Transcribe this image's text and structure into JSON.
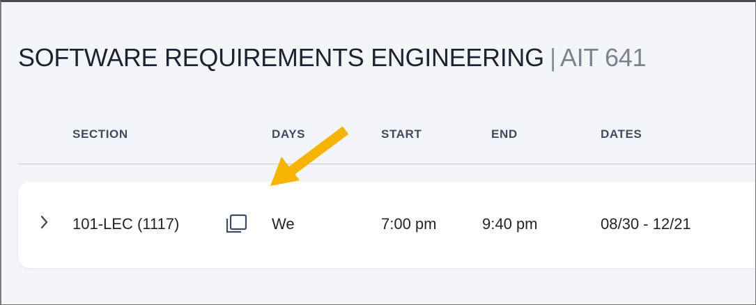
{
  "course": {
    "name": "SOFTWARE REQUIREMENTS ENGINEERING",
    "separator": "|",
    "code": "AIT 641"
  },
  "table": {
    "headers": [
      "SECTION",
      "DAYS",
      "START",
      "END",
      "DATES"
    ],
    "rows": [
      {
        "section": "101-LEC (1117)",
        "days": "We",
        "start": "7:00 pm",
        "end": "9:40 pm",
        "dates": "08/30 - 12/21"
      }
    ]
  },
  "icons": {
    "expand": "chevron-right-icon",
    "copy": "copy-icon",
    "annotation": "arrow-icon"
  },
  "colors": {
    "annotation_arrow": "#f5b400",
    "background": "#f4f5f9",
    "text": "#1e2230",
    "header_text": "#3f4a5e"
  }
}
